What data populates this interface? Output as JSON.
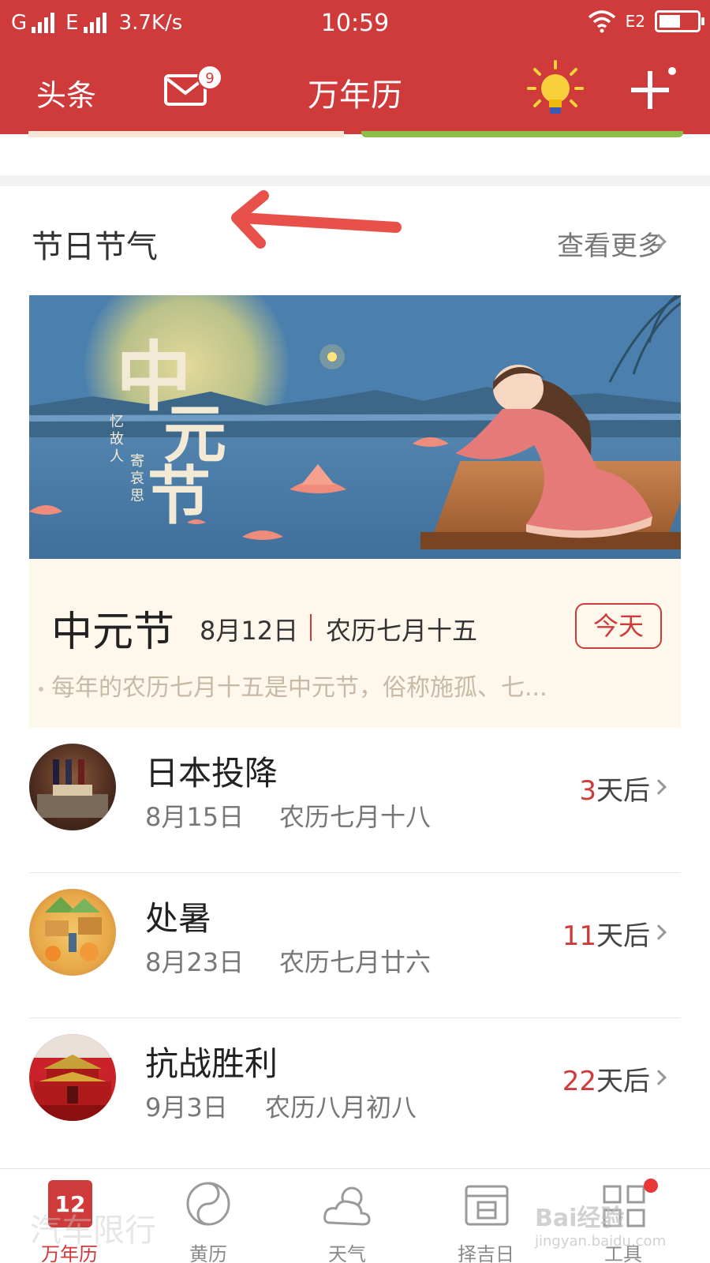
{
  "status_bar": {
    "carrier1": "G",
    "carrier2": "E",
    "speed": "3.7K/s",
    "time": "10:59",
    "network_label": "E2"
  },
  "app_bar": {
    "headline_label": "头条",
    "mail_badge": "9",
    "title": "万年历",
    "icons": [
      "mail-icon",
      "lightbulb-icon",
      "plus-icon"
    ]
  },
  "section": {
    "title": "节日节气",
    "see_more": "查看更多"
  },
  "banner": {
    "calligraphy_chars": [
      "中",
      "元",
      "节"
    ],
    "poem_left": "忆故人",
    "poem_right": "寄哀思"
  },
  "featured": {
    "name": "中元节",
    "date": "8月12日",
    "lunar": "农历七月十五",
    "today_label": "今天",
    "description": "每年的农历七月十五是中元节，俗称施孤、七..."
  },
  "events": [
    {
      "title": "日本投降",
      "date": "8月15日",
      "lunar": "农历七月十八",
      "days": "3",
      "suffix": "天后"
    },
    {
      "title": "处暑",
      "date": "8月23日",
      "lunar": "农历七月廿六",
      "days": "11",
      "suffix": "天后"
    },
    {
      "title": "抗战胜利",
      "date": "9月3日",
      "lunar": "农历八月初八",
      "days": "22",
      "suffix": "天后"
    }
  ],
  "bottom_nav": {
    "calendar_day": "12",
    "items": [
      {
        "label": "万年历",
        "active": true
      },
      {
        "label": "黄历",
        "active": false
      },
      {
        "label": "天气",
        "active": false
      },
      {
        "label": "择吉日",
        "active": false
      },
      {
        "label": "工具",
        "active": false
      }
    ]
  },
  "watermark": {
    "overlay_text": "汽车限行",
    "brand": "Bai经验",
    "url": "jingyan.baidu.com"
  },
  "colors": {
    "primary_red": "#cf3a3b",
    "card_bg": "#fdf7ec",
    "annotation_arrow": "#e8504a"
  }
}
